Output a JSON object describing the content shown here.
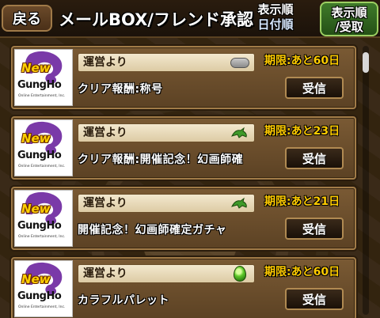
{
  "header": {
    "back_label": "戻る",
    "title": "メールBOX/フレンド承認",
    "sort_label_line1": "表示順",
    "sort_label_line2": "日付順",
    "sort_button_line1": "表示順",
    "sort_button_line2": "/受取"
  },
  "logo": {
    "new": "New",
    "name": "GungHo",
    "sub": "Online Entertainment, Inc."
  },
  "mails": [
    {
      "sender": "運営より",
      "subject": "クリア報酬:称号",
      "deadline": "期限:あと60日",
      "receive_label": "受信",
      "attachment_icon": "gray-pill-icon"
    },
    {
      "sender": "運営より",
      "subject": "クリア報酬:開催記念！幻画師確",
      "deadline": "期限:あと23日",
      "receive_label": "受信",
      "attachment_icon": "dragon-icon"
    },
    {
      "sender": "運営より",
      "subject": "開催記念！幻画師確定ガチャ",
      "deadline": "期限:あと21日",
      "receive_label": "受信",
      "attachment_icon": "dragon-icon"
    },
    {
      "sender": "運営より",
      "subject": "カラフルパレット",
      "deadline": "期限:あと60日",
      "receive_label": "受信",
      "attachment_icon": "green-egg-icon"
    }
  ]
}
